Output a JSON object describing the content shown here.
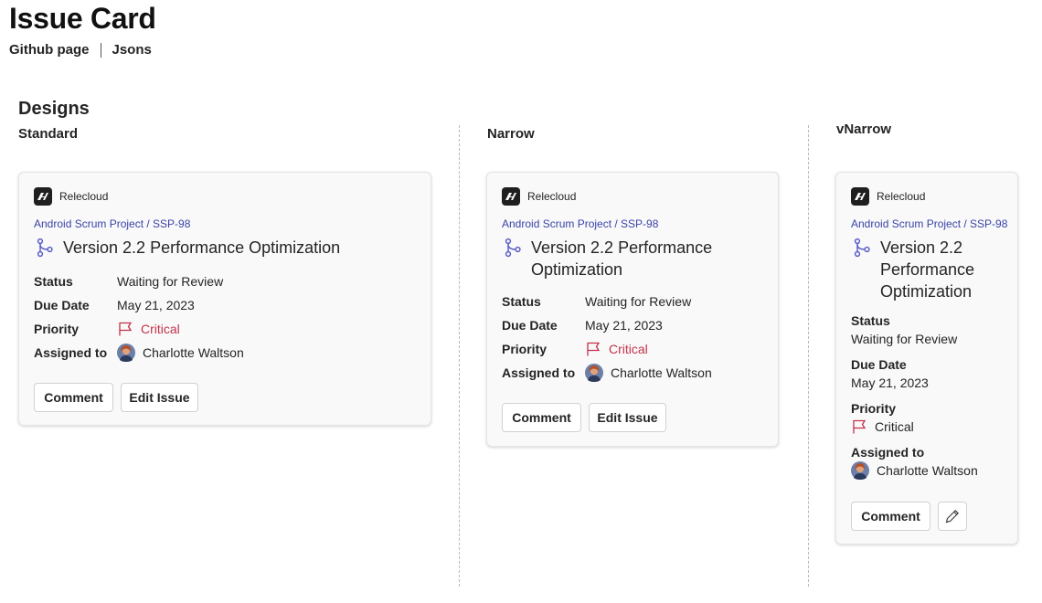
{
  "page": {
    "title": "Issue Card",
    "links": [
      "Github page",
      "Jsons"
    ],
    "section": "Designs"
  },
  "columns": {
    "standard": "Standard",
    "narrow": "Narrow",
    "vnarrow": "vNarrow"
  },
  "card": {
    "brand": "Relecloud",
    "breadcrumb": "Android Scrum Project / SSP-98",
    "title": "Version 2.2 Performance Optimization",
    "title_lines_narrow": [
      "Version 2.2 Performance",
      "Optimization"
    ],
    "title_lines_vnarrow": [
      "Version 2.2",
      "Performance",
      "Optimization"
    ],
    "fields": {
      "status_label": "Status",
      "status_value": "Waiting for Review",
      "due_label": "Due Date",
      "due_value": "May 21, 2023",
      "priority_label": "Priority",
      "priority_value": "Critical",
      "assigned_label": "Assigned to",
      "assigned_value": "Charlotte Waltson"
    },
    "buttons": {
      "comment": "Comment",
      "edit": "Edit Issue"
    },
    "icons": {
      "brand": "relecloud-logo-icon",
      "title": "branch-icon",
      "priority": "flag-icon",
      "edit_compact": "pencil-icon"
    },
    "colors": {
      "link": "#3a43a8",
      "critical": "#c4314b",
      "branch_icon": "#5b5fc7"
    }
  }
}
